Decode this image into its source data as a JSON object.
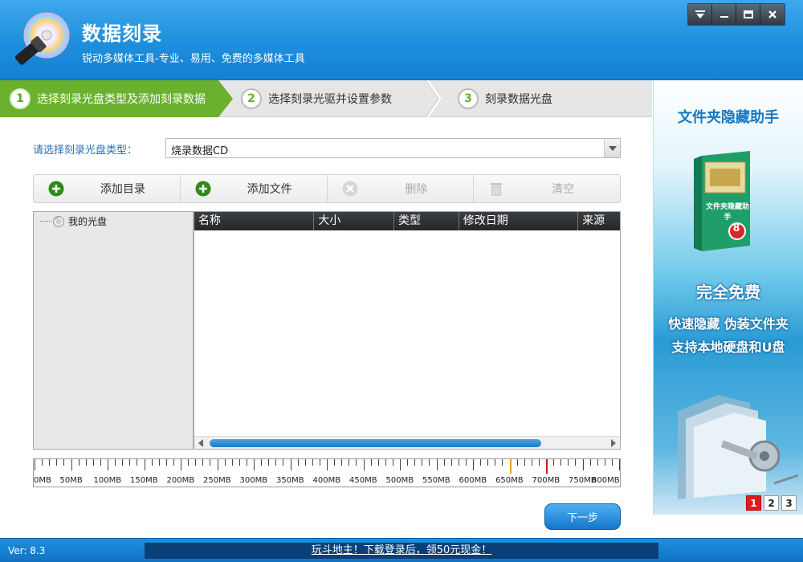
{
  "app": {
    "title": "数据刻录",
    "subtitle": "锐动多媒体工具-专业、易用、免费的多媒体工具"
  },
  "window_controls": [
    "menu-icon",
    "minimize-icon",
    "maximize-icon",
    "close-icon"
  ],
  "steps": [
    {
      "num": "1",
      "label": "选择刻录光盘类型及添加刻录数据",
      "active": true
    },
    {
      "num": "2",
      "label": "选择刻录光驱并设置参数",
      "active": false
    },
    {
      "num": "3",
      "label": "刻录数据光盘",
      "active": false
    }
  ],
  "disc_type": {
    "label": "请选择刻录光盘类型：",
    "value": "烧录数据CD"
  },
  "toolbar": {
    "add_dir": "添加目录",
    "add_file": "添加文件",
    "delete": "删除",
    "clear": "清空"
  },
  "tree": {
    "root": "我的光盘"
  },
  "filelist": {
    "columns": [
      "名称",
      "大小",
      "类型",
      "修改日期",
      "来源"
    ]
  },
  "ruler": {
    "labels": [
      "0MB",
      "50MB",
      "100MB",
      "150MB",
      "200MB",
      "250MB",
      "300MB",
      "350MB",
      "400MB",
      "450MB",
      "500MB",
      "550MB",
      "600MB",
      "650MB",
      "700MB",
      "750MB",
      "800MB"
    ],
    "markers": [
      {
        "mb": 650,
        "color": "#f0a000"
      },
      {
        "mb": 700,
        "color": "#d61a1a"
      }
    ]
  },
  "next_button": "下一步",
  "ad": {
    "title": "文件夹隐藏助手",
    "box_text": "文件夹隐藏助手",
    "box_badge": "8",
    "free": "完全免费",
    "line1": "快速隐藏 伪装文件夹",
    "line2": "支持本地硬盘和U盘",
    "pages": [
      "1",
      "2",
      "3"
    ],
    "active_page": "1"
  },
  "status": {
    "version": "Ver: 8.3",
    "promo": "玩斗地主！下载登录后，领50元现金！"
  },
  "colors": {
    "header_blue": "#1d8fdd",
    "step_active_green": "#6ab12d",
    "label_blue": "#1f6fb7"
  }
}
